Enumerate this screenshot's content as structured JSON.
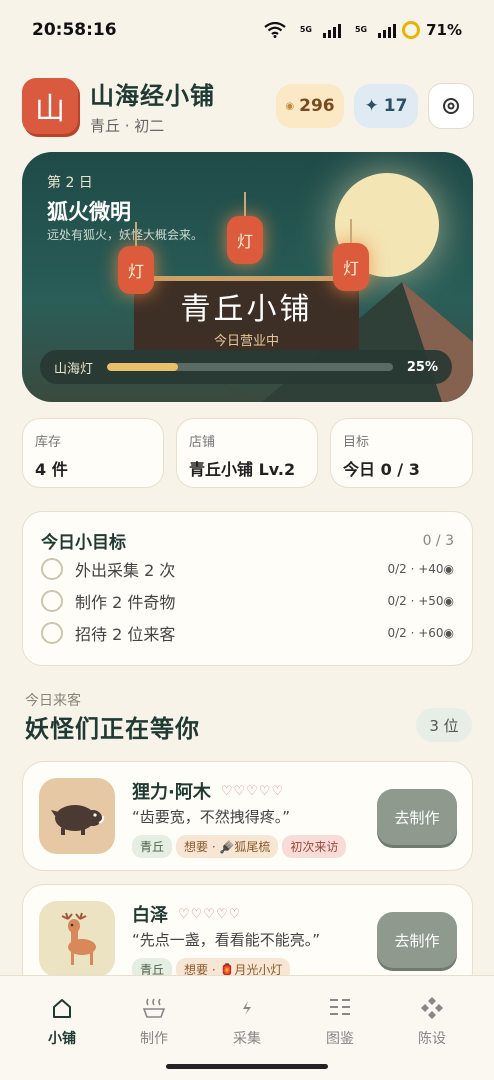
{
  "status": {
    "time": "20:58:16",
    "battery": "71%",
    "net1": "5G",
    "net2": "5G"
  },
  "header": {
    "logo_char": "山",
    "shop_name": "山海经小铺",
    "subtitle": "青丘 · 初二",
    "coins": "296",
    "stars": "17"
  },
  "hero": {
    "day": "第 2 日",
    "event": "狐火微明",
    "desc": "远处有狐火，妖怪大概会来。",
    "sign_title": "青丘小铺",
    "sign_status": "今日营业中",
    "lantern_char": "灯",
    "progress_label": "山海灯",
    "progress_value": 0.25,
    "progress_text": "25%"
  },
  "stats": [
    {
      "label": "库存",
      "value": "4 件"
    },
    {
      "label": "店铺",
      "value": "青丘小铺 Lv.2"
    },
    {
      "label": "目标",
      "value": "今日 0 / 3"
    }
  ],
  "goals": {
    "title": "今日小目标",
    "count": "0 / 3",
    "items": [
      {
        "label": "外出采集 2 次",
        "reward": "0/2 · +40◉"
      },
      {
        "label": "制作 2 件奇物",
        "reward": "0/2 · +50◉"
      },
      {
        "label": "招待 2 位来客",
        "reward": "0/2 · +60◉"
      }
    ]
  },
  "visitors": {
    "small": "今日来客",
    "title": "妖怪们正在等你",
    "count": "3 位",
    "list": [
      {
        "name": "狸力·阿木",
        "hearts": "♡♡♡♡♡",
        "quote": "“齿要宽，不然拽得疼。”",
        "place": "青丘",
        "want": "想要 · 🪮狐尾梳",
        "flag": "初次来访",
        "button": "去制作"
      },
      {
        "name": "白泽",
        "hearts": "♡♡♡♡♡",
        "quote": "“先点一盏，看看能不能亮。”",
        "place": "青丘",
        "want": "想要 · 🏮月光小灯",
        "button": "去制作"
      }
    ]
  },
  "tabs": [
    {
      "label": "小铺",
      "icon": "home-icon"
    },
    {
      "label": "制作",
      "icon": "steam-icon"
    },
    {
      "label": "采集",
      "icon": "lightning-icon"
    },
    {
      "label": "图鉴",
      "icon": "book-icon"
    },
    {
      "label": "陈设",
      "icon": "diamond-grid-icon"
    }
  ],
  "colors": {
    "accent": "#1f3a33",
    "brand": "#d95a3f",
    "button": "#8e9a8e"
  }
}
